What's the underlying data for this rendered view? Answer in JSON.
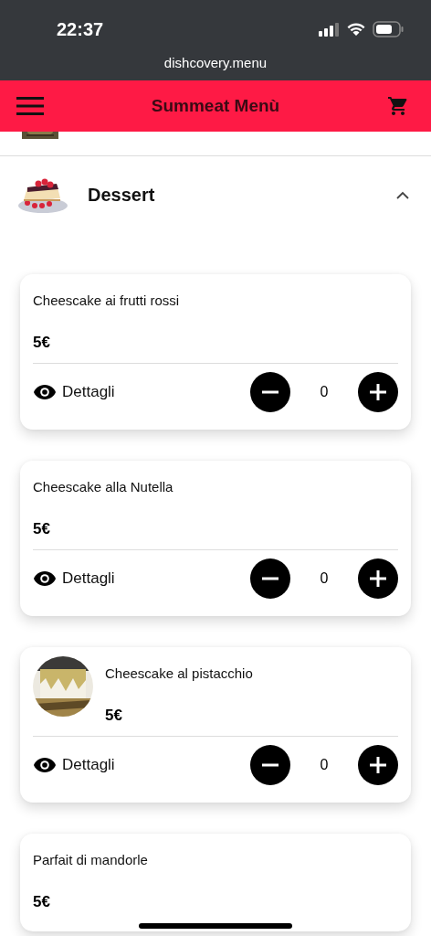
{
  "status_bar": {
    "time": "22:37",
    "url": "dishcovery.menu"
  },
  "header": {
    "title": "Summeat Menù"
  },
  "category": {
    "name": "Dessert",
    "expanded": true
  },
  "items": [
    {
      "name": "Cheescake ai frutti rossi",
      "price": "5€",
      "has_picture": false,
      "details": "Dettagli",
      "quantity": "0"
    },
    {
      "name": "Cheescake alla Nutella",
      "price": "5€",
      "has_picture": false,
      "details": "Dettagli",
      "quantity": "0"
    },
    {
      "name": "Cheescake al pistacchio",
      "price": "5€",
      "has_picture": true,
      "details": "Dettagli",
      "quantity": "0"
    },
    {
      "name": "Parfait di mandorle",
      "price": "5€",
      "has_picture": false
    }
  ]
}
